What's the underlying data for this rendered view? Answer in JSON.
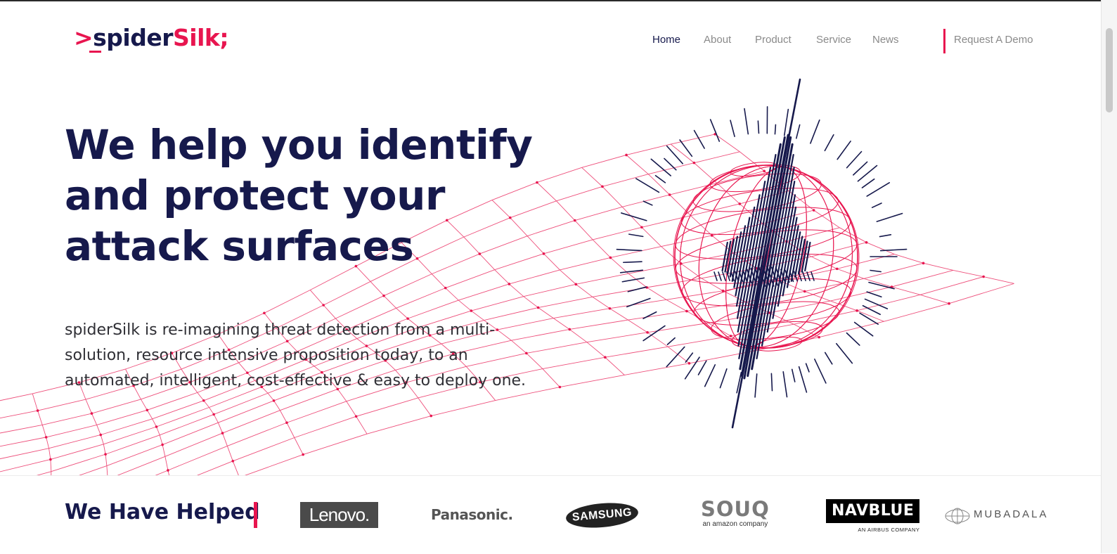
{
  "brand": {
    "logo_prompt": ">",
    "logo_part1": "spider",
    "logo_part2": "Silk",
    "logo_suffix": ";",
    "accent_color": "#e8154f",
    "navy_color": "#16194c"
  },
  "nav": {
    "items": [
      {
        "label": "Home",
        "active": true
      },
      {
        "label": "About",
        "active": false
      },
      {
        "label": "Product",
        "active": false
      },
      {
        "label": "Service",
        "active": false
      },
      {
        "label": "News",
        "active": false
      }
    ],
    "cta_label": "Request A Demo"
  },
  "hero": {
    "title_line1": "We help you identify",
    "title_line2": "and protect your",
    "title_line3": "attack surfaces",
    "description": "spiderSilk is re-imagining threat detection from a multi-solution, resource intensive proposition today, to an automated, intelligent, cost-effective & easy to deploy one.",
    "illustration_icon": "wireframe-globe-icon",
    "background_icon": "network-mesh-icon"
  },
  "clients": {
    "heading": "We Have Helped",
    "logos": [
      {
        "name": "Lenovo",
        "text": "Lenovo."
      },
      {
        "name": "Panasonic",
        "text": "Panasonic."
      },
      {
        "name": "Samsung",
        "text": "SAMSUNG"
      },
      {
        "name": "Souq",
        "text": "SOUQ",
        "subtext": "an amazon company"
      },
      {
        "name": "NavBlue",
        "text": "NAVBLUE",
        "subtext": "AN AIRBUS COMPANY"
      },
      {
        "name": "Mubadala",
        "text": "MUBADALA",
        "icon": "mubadala-emblem-icon"
      }
    ]
  }
}
